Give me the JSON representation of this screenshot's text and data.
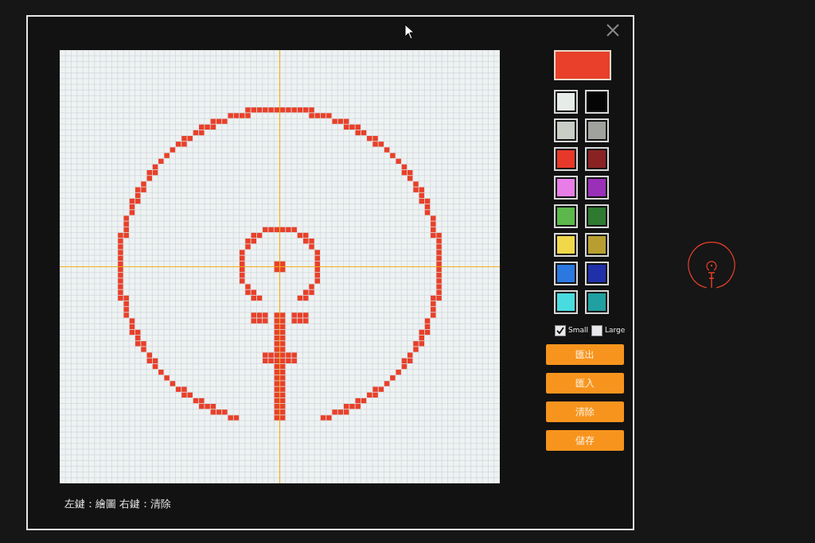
{
  "current": {
    "color": "#e8402a"
  },
  "palette": [
    {
      "color": "#e6ece8"
    },
    {
      "color": "#050505"
    },
    {
      "color": "#c8cdc6"
    },
    {
      "color": "#a0a29e"
    },
    {
      "color": "#e8382a"
    },
    {
      "color": "#8a2222"
    },
    {
      "color": "#e87de8"
    },
    {
      "color": "#9a30b8"
    },
    {
      "color": "#5cb84a"
    },
    {
      "color": "#2e7a30"
    },
    {
      "color": "#f0d84a"
    },
    {
      "color": "#b89e30"
    },
    {
      "color": "#2a78e0"
    },
    {
      "color": "#2030a8"
    },
    {
      "color": "#48dce0"
    },
    {
      "color": "#20a0a0"
    }
  ],
  "size_options": [
    {
      "label": "Small",
      "checked": true
    },
    {
      "label": "Large",
      "checked": false
    }
  ],
  "buttons": [
    "匯出",
    "匯入",
    "清除",
    "儲存"
  ],
  "hint": "左鍵：繪圖 右鍵：清除"
}
